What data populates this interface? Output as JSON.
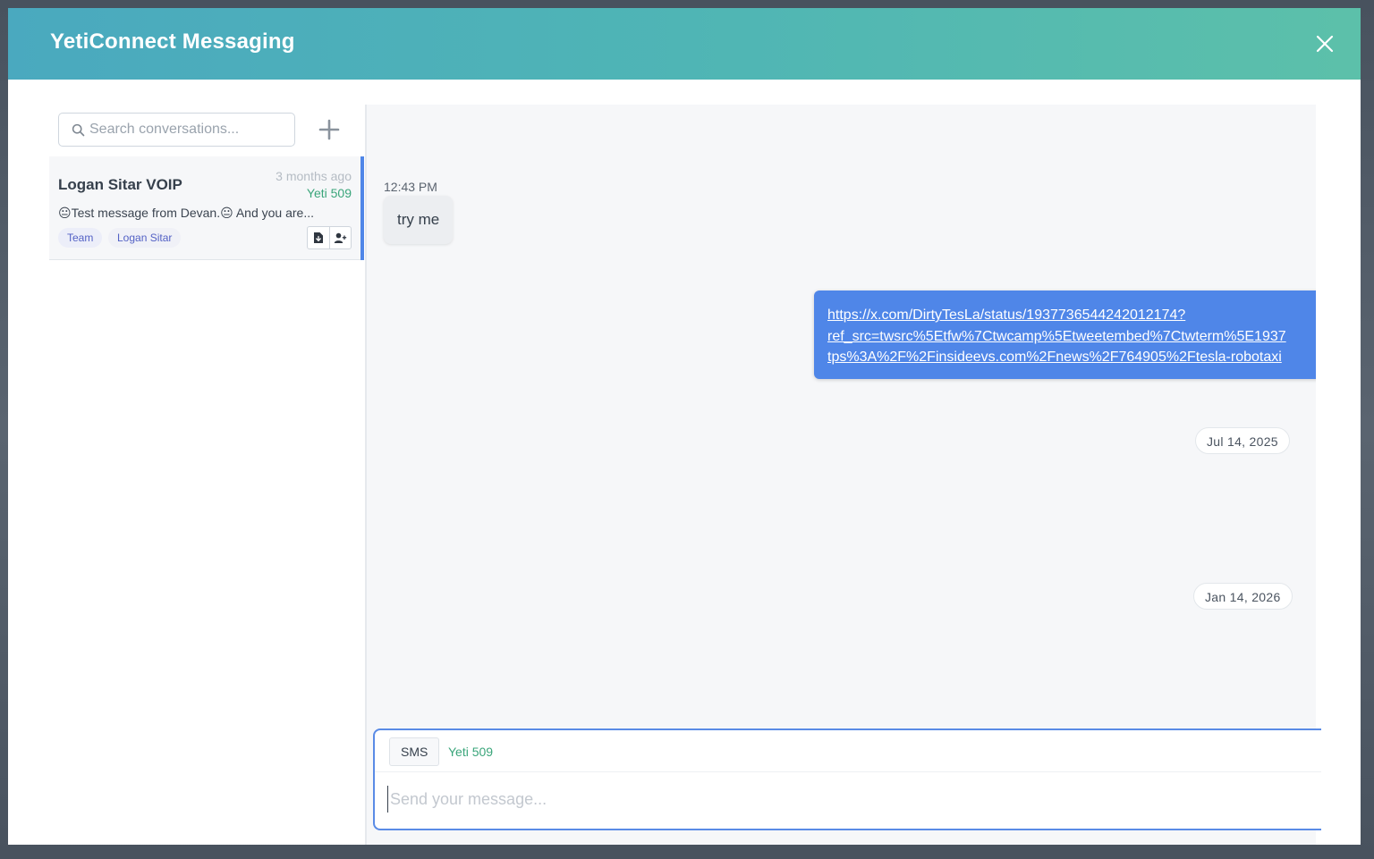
{
  "header": {
    "title": "YetiConnect Messaging",
    "close_icon": "close-icon"
  },
  "sidebar": {
    "search_placeholder": "Search conversations...",
    "add_icon": "plus-icon",
    "conversations": [
      {
        "name": "Logan Sitar VOIP",
        "time": "3 months ago",
        "line": "Yeti 509",
        "preview": "😐Test message from Devan.😐 And you are...",
        "tags": [
          "Team",
          "Logan Sitar"
        ],
        "actions": [
          "file-download-icon",
          "add-user-icon"
        ]
      }
    ]
  },
  "chat": {
    "messages": [
      {
        "direction": "in",
        "time": "12:43 PM",
        "text": "try me"
      },
      {
        "direction": "out",
        "lines": [
          "https://x.com/DirtyTesLa/status/1937736544242012174?",
          "ref_src=twsrc%5Etfw%7Ctwcamp%5Etweetembed%7Ctwterm%5E1937",
          "tps%3A%2F%2Finsideevs.com%2Fnews%2F764905%2Ftesla-robotaxi"
        ]
      }
    ],
    "date_separators": [
      "Jul 14, 2025",
      "Jan 14, 2026"
    ]
  },
  "composer": {
    "channel": "SMS",
    "line": "Yeti 509",
    "placeholder": "Send your message..."
  },
  "colors": {
    "header_gradient_start": "#4aa9bf",
    "header_gradient_end": "#5cc0aa",
    "accent_blue": "#4f86e8",
    "line_green": "#3aa57a",
    "tag_text": "#5361c5"
  }
}
